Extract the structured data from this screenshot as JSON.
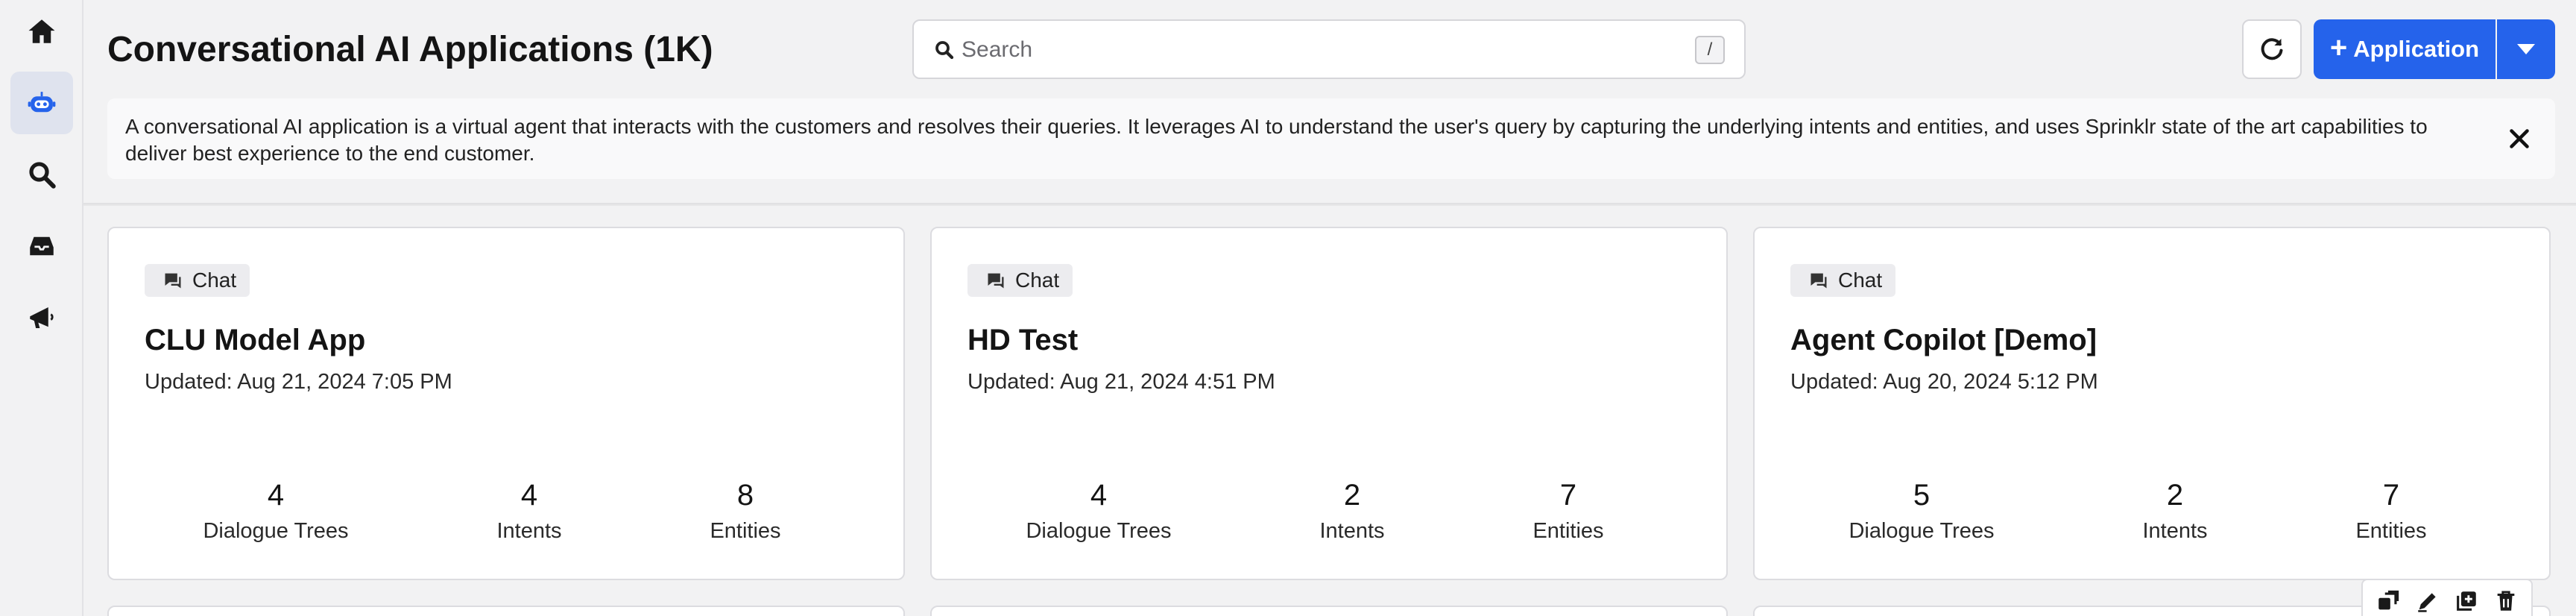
{
  "header": {
    "title": "Conversational AI Applications (1K)",
    "search_placeholder": "Search",
    "search_shortcut": "/",
    "add_button_label": "Application"
  },
  "banner": {
    "text": "A conversational AI application is a virtual agent that interacts with the customers and resolves their queries. It leverages AI to understand the user's query by capturing the underlying intents and entities, and uses Sprinklr state of the art capabilities to deliver best experience to the end customer."
  },
  "sidebar": {
    "items": [
      {
        "icon": "home-icon",
        "active": false
      },
      {
        "icon": "bot-icon",
        "active": true
      },
      {
        "icon": "search-icon",
        "active": false
      },
      {
        "icon": "inbox-icon",
        "active": false
      },
      {
        "icon": "megaphone-icon",
        "active": false
      }
    ]
  },
  "cards": [
    {
      "type": "Chat",
      "title": "CLU Model App",
      "updated": "Updated: Aug 21, 2024 7:05 PM",
      "stats": [
        {
          "value": "4",
          "label": "Dialogue Trees"
        },
        {
          "value": "4",
          "label": "Intents"
        },
        {
          "value": "8",
          "label": "Entities"
        }
      ]
    },
    {
      "type": "Chat",
      "title": "HD Test",
      "updated": "Updated: Aug 21, 2024 4:51 PM",
      "stats": [
        {
          "value": "4",
          "label": "Dialogue Trees"
        },
        {
          "value": "2",
          "label": "Intents"
        },
        {
          "value": "7",
          "label": "Entities"
        }
      ]
    },
    {
      "type": "Chat",
      "title": "Agent Copilot [Demo]",
      "updated": "Updated: Aug 20, 2024 5:12 PM",
      "stats": [
        {
          "value": "5",
          "label": "Dialogue Trees"
        },
        {
          "value": "2",
          "label": "Intents"
        },
        {
          "value": "7",
          "label": "Entities"
        }
      ]
    }
  ],
  "card_actions": [
    "clone-icon",
    "edit-icon",
    "duplicate-icon",
    "delete-icon"
  ],
  "colors": {
    "accent": "#2563eb",
    "background": "#f2f2f3",
    "card": "#ffffff"
  }
}
